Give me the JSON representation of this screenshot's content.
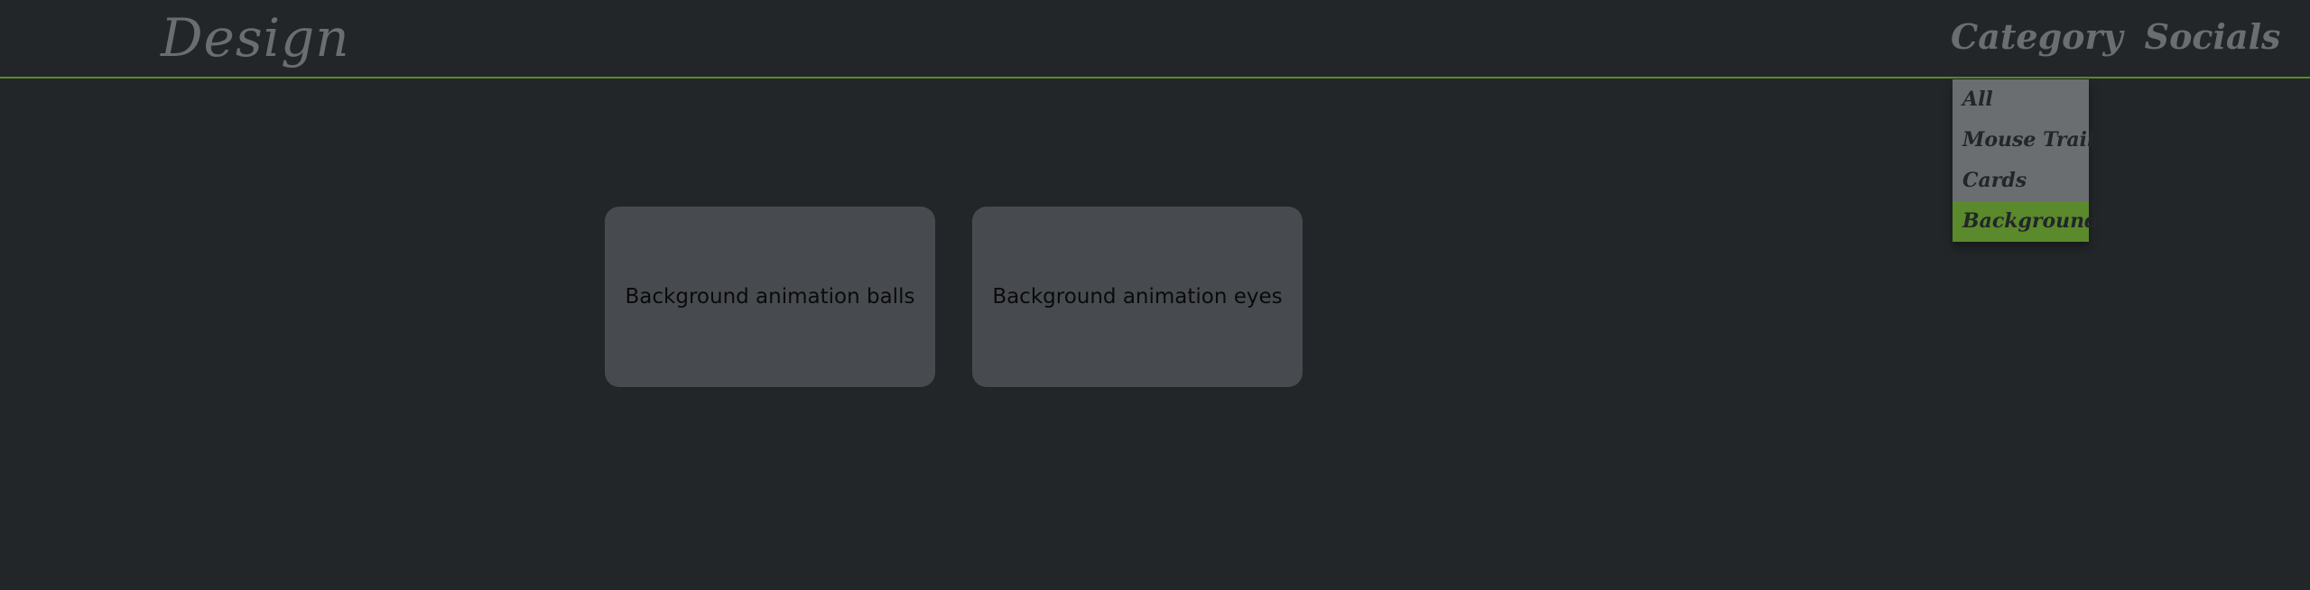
{
  "header": {
    "logo": "Design",
    "nav": [
      "Category",
      "Socials"
    ]
  },
  "category_menu": {
    "items": [
      "All",
      "Mouse Trail",
      "Cards",
      "Background"
    ],
    "selected": "Background"
  },
  "cards": [
    {
      "label": "Background animation balls"
    },
    {
      "label": "Background animation eyes"
    }
  ],
  "colors": {
    "background": "#222629",
    "accent": "#5a8a2c",
    "card": "#474b4f",
    "muted_text": "#6b6e70"
  }
}
